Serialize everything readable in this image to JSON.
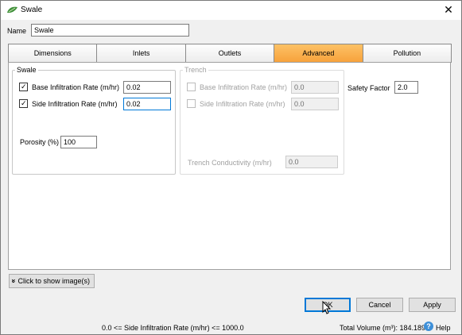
{
  "window": {
    "title": "Swale",
    "close_glyph": "✕",
    "icon": "swale-leaf-icon"
  },
  "name_field": {
    "label": "Name",
    "value": "Swale"
  },
  "tabs": [
    {
      "label": "Dimensions",
      "active": false
    },
    {
      "label": "Inlets",
      "active": false
    },
    {
      "label": "Outlets",
      "active": false
    },
    {
      "label": "Advanced",
      "active": true
    },
    {
      "label": "Pollution",
      "active": false
    }
  ],
  "swale": {
    "legend": "Swale",
    "base_rate": {
      "label": "Base Infiltration Rate (m/hr)",
      "checked": true,
      "value": "0.02"
    },
    "side_rate": {
      "label": "Side Infiltration Rate (m/hr)",
      "checked": true,
      "value": "0.02"
    },
    "porosity": {
      "label": "Porosity (%)",
      "value": "100"
    }
  },
  "trench": {
    "legend": "Trench",
    "base_rate": {
      "label": "Base Infiltration Rate (m/hr)",
      "checked": false,
      "value": "0.0"
    },
    "side_rate": {
      "label": "Side Infiltration Rate (m/hr)",
      "checked": false,
      "value": "0.0"
    },
    "conductivity": {
      "label": "Trench Conductivity (m/hr)",
      "value": "0.0"
    }
  },
  "safety_factor": {
    "label": "Safety Factor",
    "value": "2.0"
  },
  "show_image_button": {
    "glyph": "»",
    "label": "Click to show image(s)"
  },
  "buttons": {
    "ok": "OK",
    "cancel": "Cancel",
    "apply": "Apply"
  },
  "status": {
    "range_hint": "0.0 <= Side Infiltration Rate (m/hr) <= 1000.0",
    "total_volume": "Total Volume (m³): 184.189",
    "help": "Help",
    "help_glyph": "?"
  },
  "colors": {
    "active_tab": "#f7a23c",
    "focus_border": "#0078d7",
    "help_icon": "#3d8fd8"
  }
}
